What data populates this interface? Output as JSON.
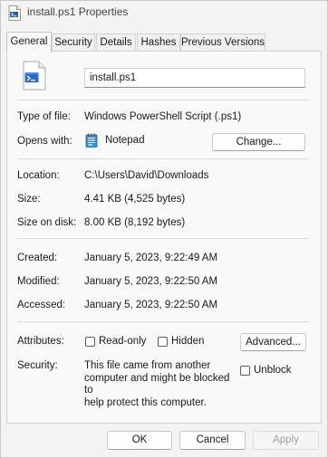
{
  "window": {
    "title": "install.ps1 Properties"
  },
  "tabs": [
    {
      "label": "General",
      "active": true
    },
    {
      "label": "Security",
      "active": false
    },
    {
      "label": "Details",
      "active": false
    },
    {
      "label": "Hashes",
      "active": false
    },
    {
      "label": "Previous Versions",
      "active": false
    }
  ],
  "general": {
    "file_name": "install.ps1",
    "type_of_file": {
      "label": "Type of file:",
      "value": "Windows PowerShell Script (.ps1)"
    },
    "opens_with": {
      "label": "Opens with:",
      "value": "Notepad",
      "icon": "notepad-icon",
      "change_button": "Change..."
    },
    "location": {
      "label": "Location:",
      "value": "C:\\Users\\David\\Downloads"
    },
    "size": {
      "label": "Size:",
      "value": "4.41 KB (4,525 bytes)"
    },
    "size_on_disk": {
      "label": "Size on disk:",
      "value": "8.00 KB (8,192 bytes)"
    },
    "created": {
      "label": "Created:",
      "value": "January 5, 2023, 9:22:49 AM"
    },
    "modified": {
      "label": "Modified:",
      "value": "January 5, 2023, 9:22:50 AM"
    },
    "accessed": {
      "label": "Accessed:",
      "value": "January 5, 2023, 9:22:50 AM"
    },
    "attributes": {
      "label": "Attributes:",
      "read_only": {
        "label": "Read-only",
        "checked": false
      },
      "hidden": {
        "label": "Hidden",
        "checked": false
      },
      "advanced_button": "Advanced..."
    },
    "security": {
      "label": "Security:",
      "lines": [
        "This file came from another",
        "computer and might be blocked to",
        "help protect this computer."
      ],
      "unblock": {
        "label": "Unblock",
        "checked": false
      }
    }
  },
  "footer": {
    "ok": "OK",
    "cancel": "Cancel",
    "apply": "Apply"
  },
  "colors": {
    "accent": "#0067c0",
    "window_bg": "#f3f3f3",
    "panel_bg": "#f9f9f9"
  }
}
